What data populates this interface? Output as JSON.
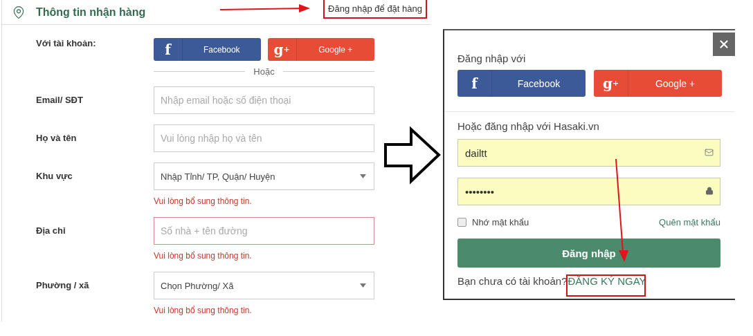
{
  "checkout": {
    "title": "Thông tin nhận hàng",
    "login_link": "Đăng nhập để đặt hàng",
    "social_label": "Với tài khoản:",
    "social_buttons": [
      {
        "kind": "facebook",
        "icon": "f",
        "label": "Facebook"
      },
      {
        "kind": "google",
        "icon": "g$^{+}$",
        "label": "Google +"
      }
    ],
    "divider": "Hoặc",
    "fields": [
      {
        "kind": "input",
        "label": "Email/ SĐT",
        "placeholder": "Nhập email hoặc số điện thoại",
        "invalid": false
      },
      {
        "kind": "input",
        "label": "Họ và tên",
        "placeholder": "Vui lòng nhập họ và tên",
        "invalid": false
      },
      {
        "kind": "select",
        "label": "Khu vực",
        "value": "Nhập Tỉnh/ TP, Quận/ Huyện",
        "invalid": false,
        "error": "Vui lòng bổ sung thông tin."
      },
      {
        "kind": "input",
        "label": "Địa chỉ",
        "placeholder": "Số nhà + tên đường",
        "invalid": true,
        "error": "Vui lòng bổ sung thông tin."
      },
      {
        "kind": "select",
        "label": "Phường / xã",
        "value": "Chọn Phường/ Xã",
        "invalid": false,
        "error": "Vui lòng bổ sung thông tin."
      }
    ]
  },
  "login_modal": {
    "social_title": "Đăng nhập với",
    "social_buttons": [
      {
        "kind": "facebook",
        "icon": "f",
        "label": "Facebook"
      },
      {
        "kind": "google",
        "icon": "g$^{+}$",
        "label": "Google +"
      }
    ],
    "form_title": "Hoặc đăng nhập với Hasaki.vn",
    "fields": [
      {
        "kind": "email",
        "value": "dailtt"
      },
      {
        "kind": "password",
        "value": "••••••••"
      }
    ],
    "remember": {
      "label": "Nhớ mật khẩu",
      "checked": false
    },
    "forgot_link": "Quên mật khẩu",
    "submit": "Đăng nhập",
    "signup_prompt": "Bạn chưa có tài khoản?",
    "signup_link": "ĐĂNG KÝ NGAY"
  }
}
